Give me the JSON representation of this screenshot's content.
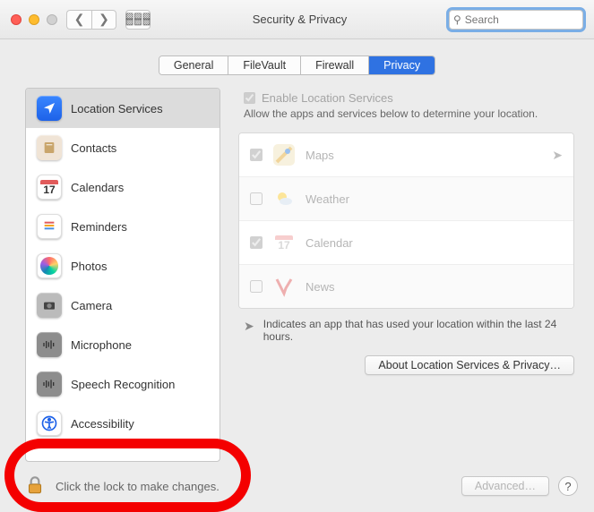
{
  "window": {
    "title": "Security & Privacy"
  },
  "search": {
    "placeholder": "Search"
  },
  "tabs": [
    {
      "label": "General"
    },
    {
      "label": "FileVault"
    },
    {
      "label": "Firewall"
    },
    {
      "label": "Privacy",
      "active": true
    }
  ],
  "sidebar": {
    "items": [
      {
        "label": "Location Services"
      },
      {
        "label": "Contacts"
      },
      {
        "label": "Calendars",
        "day": "17"
      },
      {
        "label": "Reminders"
      },
      {
        "label": "Photos"
      },
      {
        "label": "Camera"
      },
      {
        "label": "Microphone"
      },
      {
        "label": "Speech Recognition"
      },
      {
        "label": "Accessibility"
      }
    ]
  },
  "panel": {
    "enable_label": "Enable Location Services",
    "description": "Allow the apps and services below to determine your location.",
    "apps": [
      {
        "name": "Maps",
        "checked": true,
        "recent": true
      },
      {
        "name": "Weather",
        "checked": false,
        "recent": false
      },
      {
        "name": "Calendar",
        "checked": true,
        "recent": false
      },
      {
        "name": "News",
        "checked": false,
        "recent": false
      }
    ],
    "indicator_text": "Indicates an app that has used your location within the last 24 hours.",
    "about_button": "About Location Services & Privacy…"
  },
  "footer": {
    "lock_text": "Click the lock to make changes.",
    "advanced_button": "Advanced…",
    "help_label": "?"
  }
}
